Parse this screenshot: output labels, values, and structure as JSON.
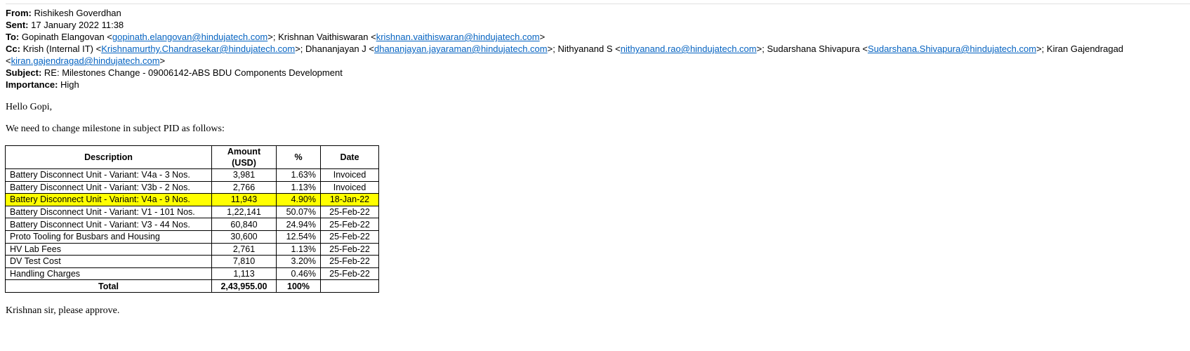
{
  "header": {
    "from_label": "From:",
    "from_value": "Rishikesh Goverdhan",
    "sent_label": "Sent:",
    "sent_value": "17 January 2022 11:38",
    "to_label": "To:",
    "to": [
      {
        "name": "Gopinath Elangovan",
        "email": "gopinath.elangovan@hindujatech.com"
      },
      {
        "name": "Krishnan Vaithiswaran",
        "email": "krishnan.vaithiswaran@hindujatech.com"
      }
    ],
    "cc_label": "Cc:",
    "cc": [
      {
        "name": "Krish (Internal IT)",
        "email": "Krishnamurthy.Chandrasekar@hindujatech.com"
      },
      {
        "name": "Dhananjayan J",
        "email": "dhananjayan.jayaraman@hindujatech.com"
      },
      {
        "name": "Nithyanand S",
        "email": "nithyanand.rao@hindujatech.com"
      },
      {
        "name": "Sudarshana Shivapura",
        "email": "Sudarshana.Shivapura@hindujatech.com"
      },
      {
        "name": "Kiran Gajendragad",
        "email": "kiran.gajendragad@hindujatech.com"
      }
    ],
    "subject_label": "Subject:",
    "subject_value": "RE: Milestones Change - 09006142-ABS BDU Components Development",
    "importance_label": "Importance:",
    "importance_value": "High"
  },
  "body": {
    "greeting": "Hello Gopi,",
    "intro": "We need to change milestone in subject PID as follows:",
    "closing": "Krishnan sir, please approve."
  },
  "table": {
    "columns": [
      "Description",
      "Amount (USD)",
      "%",
      "Date"
    ],
    "rows": [
      {
        "description": "Battery Disconnect Unit - Variant: V4a - 3 Nos.",
        "amount": "3,981",
        "percent": "1.63%",
        "date": "Invoiced",
        "highlight": false
      },
      {
        "description": "Battery Disconnect Unit - Variant: V3b - 2 Nos.",
        "amount": "2,766",
        "percent": "1.13%",
        "date": "Invoiced",
        "highlight": false
      },
      {
        "description": "Battery Disconnect Unit - Variant: V4a - 9 Nos.",
        "amount": "11,943",
        "percent": "4.90%",
        "date": "18-Jan-22",
        "highlight": true
      },
      {
        "description": "Battery Disconnect Unit - Variant: V1 - 101 Nos.",
        "amount": "1,22,141",
        "percent": "50.07%",
        "date": "25-Feb-22",
        "highlight": false
      },
      {
        "description": "Battery Disconnect Unit - Variant: V3 - 44 Nos.",
        "amount": "60,840",
        "percent": "24.94%",
        "date": "25-Feb-22",
        "highlight": false
      },
      {
        "description": "Proto Tooling for Busbars and Housing",
        "amount": "30,600",
        "percent": "12.54%",
        "date": "25-Feb-22",
        "highlight": false
      },
      {
        "description": "HV Lab Fees",
        "amount": "2,761",
        "percent": "1.13%",
        "date": "25-Feb-22",
        "highlight": false
      },
      {
        "description": "DV Test Cost",
        "amount": "7,810",
        "percent": "3.20%",
        "date": "25-Feb-22",
        "highlight": false
      },
      {
        "description": "Handling Charges",
        "amount": "1,113",
        "percent": "0.46%",
        "date": "25-Feb-22",
        "highlight": false
      }
    ],
    "total": {
      "label": "Total",
      "amount": "2,43,955.00",
      "percent": "100%",
      "date": ""
    }
  },
  "colors": {
    "link": "#0563c1",
    "highlight": "#ffff00"
  }
}
